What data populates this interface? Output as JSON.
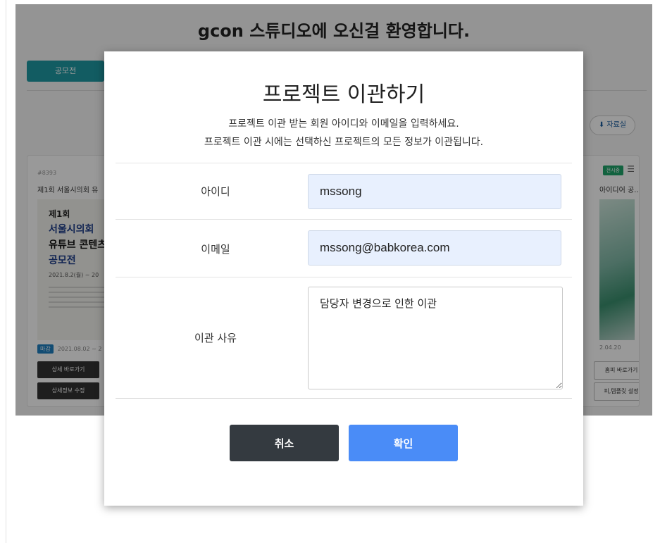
{
  "background": {
    "page_title": "gcon 스튜디오에 오신걸 환영합니다.",
    "tab_label": "공모전",
    "resource_button": "자료실",
    "left_card": {
      "number": "#8393",
      "title": "제1회 서울시의회 유",
      "poster_lines": [
        "제1회",
        "서울시의회",
        "유튜브 콘텐츠",
        "공모전",
        "2021.8.2(월) ~ 20"
      ],
      "date_tag": "마감",
      "date": "2021.08.02 ~ 2",
      "buttons": [
        "상세 바로가기",
        "상세정보 수정"
      ]
    },
    "right_card": {
      "badge": "전시중",
      "title": "아이디어 공…",
      "date": "2.04.20",
      "buttons": [
        "홈피 바로가기",
        "피,템플릿 설정"
      ]
    }
  },
  "modal": {
    "title": "프로젝트 이관하기",
    "description_line1": "프로젝트 이관 받는 회원 아이디와 이메일을 입력하세요.",
    "description_line2": "프로젝트 이관 시에는 선택하신 프로젝트의 모든 정보가 이관됩니다.",
    "fields": {
      "id_label": "아이디",
      "id_value": "mssong",
      "email_label": "이메일",
      "email_value": "mssong@babkorea.com",
      "reason_label": "이관 사유",
      "reason_value": "담당자 변경으로 인한 이관"
    },
    "cancel_label": "취소",
    "confirm_label": "확인"
  }
}
